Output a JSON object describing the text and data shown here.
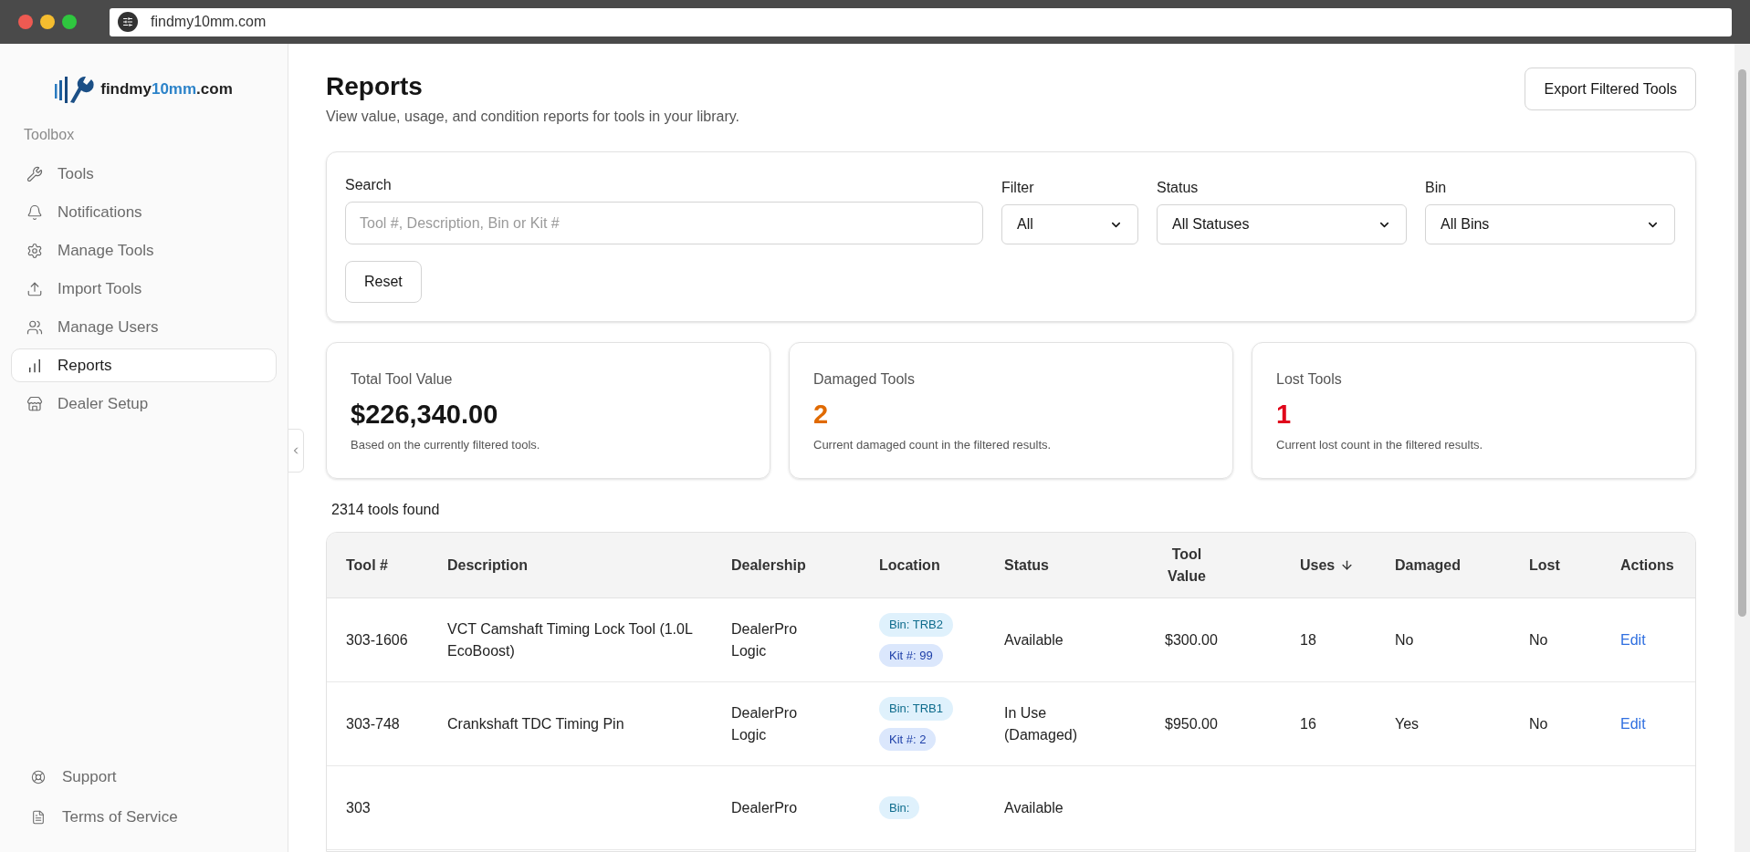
{
  "browser": {
    "url": "findmy10mm.com"
  },
  "sidebar": {
    "logo": {
      "start": "findmy",
      "accent": "10mm",
      "end": ".com"
    },
    "section": "Toolbox",
    "items": [
      {
        "label": "Tools",
        "selected": false
      },
      {
        "label": "Notifications",
        "selected": false
      },
      {
        "label": "Manage Tools",
        "selected": false
      },
      {
        "label": "Import Tools",
        "selected": false
      },
      {
        "label": "Manage Users",
        "selected": false
      },
      {
        "label": "Reports",
        "selected": true
      },
      {
        "label": "Dealer Setup",
        "selected": false
      }
    ],
    "footer_items": [
      {
        "label": "Support"
      },
      {
        "label": "Terms of Service"
      }
    ]
  },
  "page": {
    "title": "Reports",
    "subtitle": "View value, usage, and condition reports for tools in your library.",
    "export_button": "Export Filtered Tools"
  },
  "filters": {
    "search": {
      "label": "Search",
      "placeholder": "Tool #, Description, Bin or Kit #"
    },
    "selects": [
      {
        "label": "Filter",
        "value": "All"
      },
      {
        "label": "Status",
        "value": "All Statuses"
      },
      {
        "label": "Bin",
        "value": "All Bins"
      }
    ],
    "reset_button": "Reset"
  },
  "stats": [
    {
      "title": "Total Tool Value",
      "value": "$226,340.00",
      "note": "Based on the currently filtered tools.",
      "color": "#151515"
    },
    {
      "title": "Damaged Tools",
      "value": "2",
      "note": "Current damaged count in the filtered results.",
      "color": "#e06a00"
    },
    {
      "title": "Lost Tools",
      "value": "1",
      "note": "Current lost count in the filtered results.",
      "color": "#e0061b"
    }
  ],
  "result_count": "2314 tools found",
  "table": {
    "columns": [
      {
        "label": "Tool #",
        "sorted": false
      },
      {
        "label": "Description",
        "sorted": false
      },
      {
        "label": "Dealership",
        "sorted": false
      },
      {
        "label": "Location",
        "sorted": false
      },
      {
        "label": "Status",
        "sorted": false
      },
      {
        "label": "Tool Value",
        "sorted": false
      },
      {
        "label": "Uses",
        "sorted": true
      },
      {
        "label": "Damaged",
        "sorted": false
      },
      {
        "label": "Lost",
        "sorted": false
      },
      {
        "label": "Actions",
        "sorted": false
      }
    ],
    "rows": [
      {
        "tool": "303-1606",
        "description": "VCT Camshaft Timing Lock Tool (1.0L EcoBoost)",
        "dealership": "DealerPro Logic",
        "tags": [
          {
            "kind": "bin",
            "text": "Bin: TRB2"
          },
          {
            "kind": "kit",
            "text": "Kit #: 99"
          }
        ],
        "status": "Available",
        "value": "$300.00",
        "uses": "18",
        "damaged": "No",
        "lost": "No",
        "action": "Edit"
      },
      {
        "tool": "303-748",
        "description": "Crankshaft TDC Timing Pin",
        "dealership": "DealerPro Logic",
        "tags": [
          {
            "kind": "bin",
            "text": "Bin: TRB1"
          },
          {
            "kind": "kit",
            "text": "Kit #: 2"
          }
        ],
        "status": "In Use (Damaged)",
        "value": "$950.00",
        "uses": "16",
        "damaged": "Yes",
        "lost": "No",
        "action": "Edit"
      },
      {
        "tool": "303",
        "dealership": "DealerPro",
        "tags": [
          {
            "kind": "bin",
            "text": "Bin:"
          }
        ],
        "status": "Available"
      }
    ]
  }
}
